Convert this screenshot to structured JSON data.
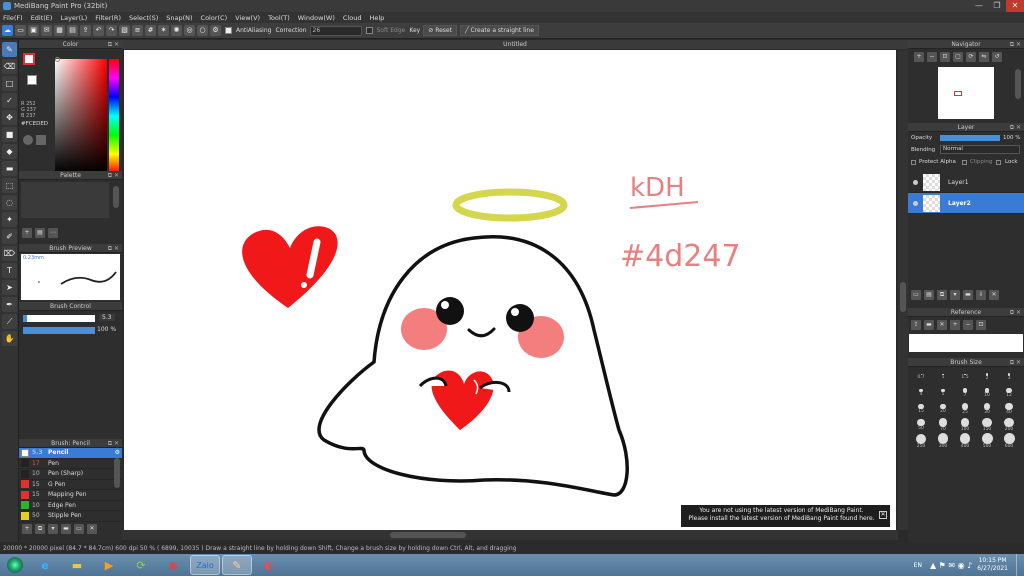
{
  "window": {
    "title": "MediBang Paint Pro (32bit)",
    "min": "—",
    "max": "❐",
    "close": "✕"
  },
  "menu": [
    "File(F)",
    "Edit(E)",
    "Layer(L)",
    "Filter(R)",
    "Select(S)",
    "Snap(N)",
    "Color(C)",
    "View(V)",
    "Tool(T)",
    "Window(W)",
    "Cloud",
    "Help"
  ],
  "toolbar": {
    "antialiasing": "AntiAliasing",
    "correction_label": "Correction",
    "correction_value": "26",
    "soft_edge": "Soft Edge",
    "key": "Key",
    "reset": "Reset",
    "straight_line": "Create a straight line"
  },
  "color_panel": {
    "title": "Color",
    "r": "R 252",
    "g": "G 237",
    "b": "B 237",
    "hex": "#FCEDED"
  },
  "palette_panel": {
    "title": "Palette"
  },
  "brush_preview": {
    "title": "Brush Preview",
    "size": "0.23mm"
  },
  "brush_control": {
    "title": "Brush Control",
    "size_value": "5.3",
    "opacity_value": "100 %"
  },
  "brush_list": {
    "title": "Brush: Pencil",
    "items": [
      {
        "size": "5.3",
        "name": "Pencil",
        "color": "#ffffff",
        "selected": true
      },
      {
        "size": "17",
        "name": "Pen",
        "color": "#222222",
        "selected": false
      },
      {
        "size": "10",
        "name": "Pen (Sharp)",
        "color": "#222222",
        "selected": false
      },
      {
        "size": "15",
        "name": "G Pen",
        "color": "#e03030",
        "selected": false
      },
      {
        "size": "15",
        "name": "Mapping Pen",
        "color": "#e03030",
        "selected": false
      },
      {
        "size": "10",
        "name": "Edge Pen",
        "color": "#30b030",
        "selected": false
      },
      {
        "size": "50",
        "name": "Stipple Pen",
        "color": "#e0d020",
        "selected": false
      }
    ]
  },
  "document": {
    "tab": "Untitled"
  },
  "canvas_text": {
    "line1": "kDH",
    "line2": "#4d247"
  },
  "notification": {
    "line1": "You are not using the latest version of MediBang Paint.",
    "line2": "Please install the latest version of MediBang Paint found here.",
    "close": "✕"
  },
  "navigator": {
    "title": "Navigator"
  },
  "layer_panel": {
    "title": "Layer",
    "opacity_label": "Opacity",
    "opacity_value": "100 %",
    "blending_label": "Blending",
    "blending_value": "Normal",
    "protect_alpha": "Protect Alpha",
    "clipping": "Clipping",
    "lock": "Lock",
    "layers": [
      {
        "name": "Layer1",
        "selected": false
      },
      {
        "name": "Layer2",
        "selected": true
      }
    ]
  },
  "reference_panel": {
    "title": "Reference"
  },
  "brush_size_panel": {
    "title": "Brush Size",
    "sizes": [
      "0.7",
      "1",
      "1.5",
      "2",
      "3",
      "4",
      "5",
      "7",
      "10",
      "12",
      "15",
      "20",
      "25",
      "30",
      "40",
      "50",
      "70",
      "100",
      "150",
      "200",
      "250",
      "300",
      "400",
      "500",
      "600"
    ]
  },
  "statusbar": {
    "text": "20000 * 20000 pixel  (84.7 * 84.7cm)  600 dpi  50 %  ( 6899, 10035 )  Draw a straight line by holding down Shift, Change a brush size by holding down Ctrl, Alt, and dragging"
  },
  "taskbar": {
    "language": "EN",
    "time": "10:15 PM",
    "date": "6/27/2021"
  }
}
